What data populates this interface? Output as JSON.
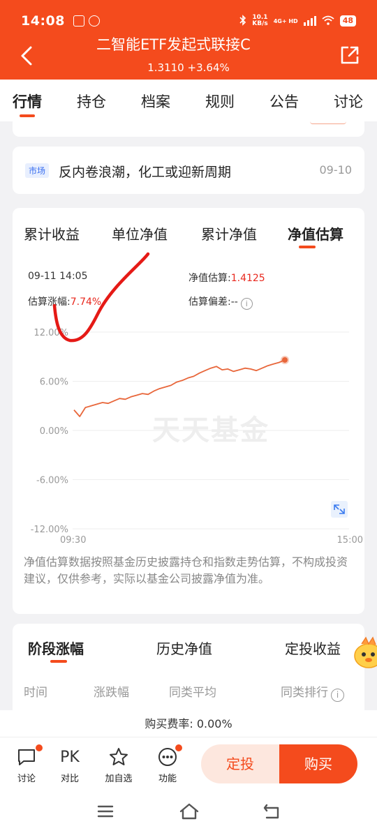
{
  "status_bar": {
    "time": "14:08",
    "speed_top": "10.1",
    "speed_bottom": "KB/s",
    "network": "4G+ HD",
    "battery": "48"
  },
  "header": {
    "title": "二智能ETF发起式联接C",
    "nav_value": "1.3110",
    "change": "+3.64%"
  },
  "tabs": [
    "行情",
    "持仓",
    "档案",
    "规则",
    "公告",
    "讨论"
  ],
  "news": {
    "tag": "市场",
    "text": "反内卷浪潮，化工或迎新周期",
    "date": "09-10"
  },
  "chart_tabs": [
    "累计收益",
    "单位净值",
    "累计净值",
    "净值估算"
  ],
  "estimate": {
    "datetime": "09-11 14:05",
    "change_label": "估算涨幅:",
    "change_value": "7.74%",
    "nav_label": "净值估算:",
    "nav_value": "1.4125",
    "deviation_label": "估算偏差:",
    "deviation_value": "--",
    "info_icon": "i"
  },
  "watermark": "天天基金",
  "chart_data": {
    "type": "line",
    "title": "",
    "xlabel": "",
    "ylabel": "",
    "ylim": [
      -12,
      12
    ],
    "yticks": [
      "12.00%",
      "6.00%",
      "0.00%",
      "-6.00%",
      "-12.00%"
    ],
    "x_start": "09:30",
    "x_end": "15:00",
    "color": "#e8663a",
    "series": [
      {
        "values": [
          2.5,
          1.7,
          2.8,
          3.0,
          3.2,
          3.4,
          3.3,
          3.6,
          3.9,
          3.8,
          4.1,
          4.3,
          4.5,
          4.4,
          4.8,
          5.1,
          5.3,
          5.5,
          5.9,
          6.1,
          6.4,
          6.6,
          7.0,
          7.3,
          7.6,
          7.8,
          7.4,
          7.5,
          7.2,
          7.4,
          7.6,
          7.5,
          7.3,
          7.6,
          7.9,
          8.1,
          8.3,
          8.6
        ]
      }
    ]
  },
  "disclaimer": "净值估算数据按照基金历史披露持仓和指数走势估算，不构成投资建议，仅供参考，实际以基金公司披露净值为准。",
  "stage_tabs": [
    "阶段涨幅",
    "历史净值",
    "定投收益"
  ],
  "stage_columns": [
    "时间",
    "涨跌幅",
    "同类平均",
    "同类排行"
  ],
  "fee": "购买费率: 0.00%",
  "bottom_nav": [
    "讨论",
    "对比",
    "加自选",
    "功能"
  ],
  "pk_label": "PK",
  "actions": {
    "plan": "定投",
    "buy": "购买"
  }
}
